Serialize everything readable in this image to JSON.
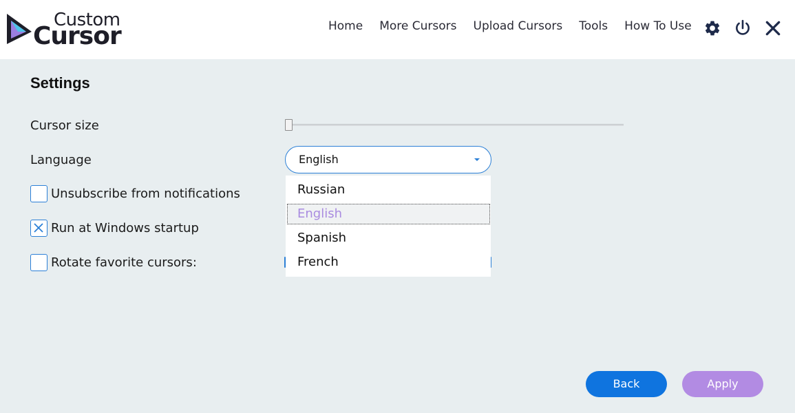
{
  "app": {
    "logo_top": "Custom",
    "logo_bottom": "Cursor",
    "accent_color": "#2b7fd6"
  },
  "nav": {
    "items": [
      {
        "label": "Home"
      },
      {
        "label": "More Cursors"
      },
      {
        "label": "Upload Cursors"
      },
      {
        "label": "Tools"
      },
      {
        "label": "How To Use"
      }
    ]
  },
  "header_icons": [
    "gear-icon",
    "power-icon",
    "close-icon"
  ],
  "settings": {
    "title": "Settings",
    "cursor_size_label": "Cursor size",
    "cursor_size_value": 0,
    "language_label": "Language",
    "language_value": "English",
    "language_options": [
      "Russian",
      "English",
      "Spanish",
      "French"
    ],
    "language_selected_index": 1,
    "unsubscribe_label": "Unsubscribe from notifications",
    "unsubscribe_checked": false,
    "startup_label": "Run at Windows startup",
    "startup_checked": true,
    "rotate_label": "Rotate favorite cursors:",
    "rotate_checked": false
  },
  "buttons": {
    "back_label": "Back",
    "apply_label": "Apply"
  }
}
